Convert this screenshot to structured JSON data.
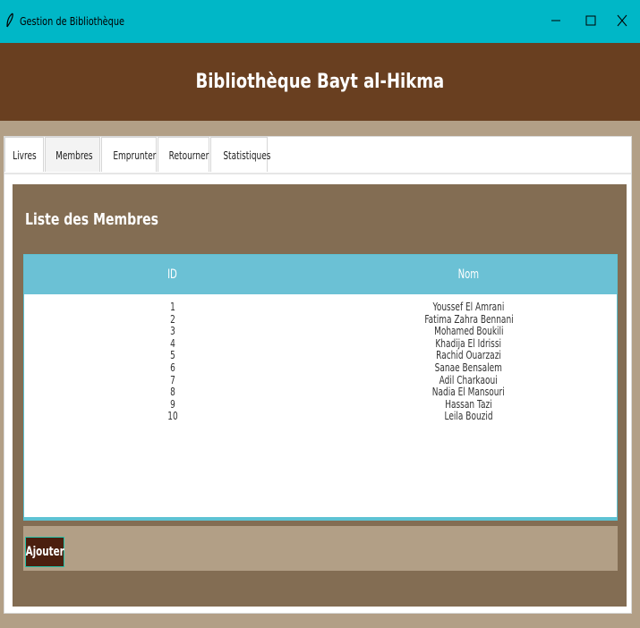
{
  "window": {
    "title": "Gestion de Bibliothèque",
    "icon": "feather-icon",
    "controls": {
      "minimize": "–",
      "maximize": "☐",
      "close": "X"
    },
    "titlebar_color": "#00b7c7"
  },
  "header": {
    "title": "Bibliothèque Bayt al-Hikma",
    "background": "#693f20"
  },
  "tabs": [
    {
      "label": "Livres",
      "active": false
    },
    {
      "label": "Membres",
      "active": true
    },
    {
      "label": "Emprunter",
      "active": false
    },
    {
      "label": "Retourner",
      "active": false
    },
    {
      "label": "Statistiques",
      "active": false
    }
  ],
  "panel": {
    "heading": "Liste des Membres",
    "background": "#836d53"
  },
  "table": {
    "columns": [
      "ID",
      "Nom"
    ],
    "header_color": "#6bc1d5",
    "rows": [
      {
        "id": "1",
        "nom": "Youssef El Amrani"
      },
      {
        "id": "2",
        "nom": "Fatima Zahra Bennani"
      },
      {
        "id": "3",
        "nom": "Mohamed Boukili"
      },
      {
        "id": "4",
        "nom": "Khadija El Idrissi"
      },
      {
        "id": "5",
        "nom": "Rachid Ouarzazi"
      },
      {
        "id": "6",
        "nom": "Sanae Bensalem"
      },
      {
        "id": "7",
        "nom": "Adil Charkaoui"
      },
      {
        "id": "8",
        "nom": "Nadia El Mansouri"
      },
      {
        "id": "9",
        "nom": "Hassan Tazi"
      },
      {
        "id": "10",
        "nom": "Leila Bouzid"
      }
    ]
  },
  "toolbar": {
    "add_label": "Ajouter",
    "add_color": "#4b1f0f"
  }
}
